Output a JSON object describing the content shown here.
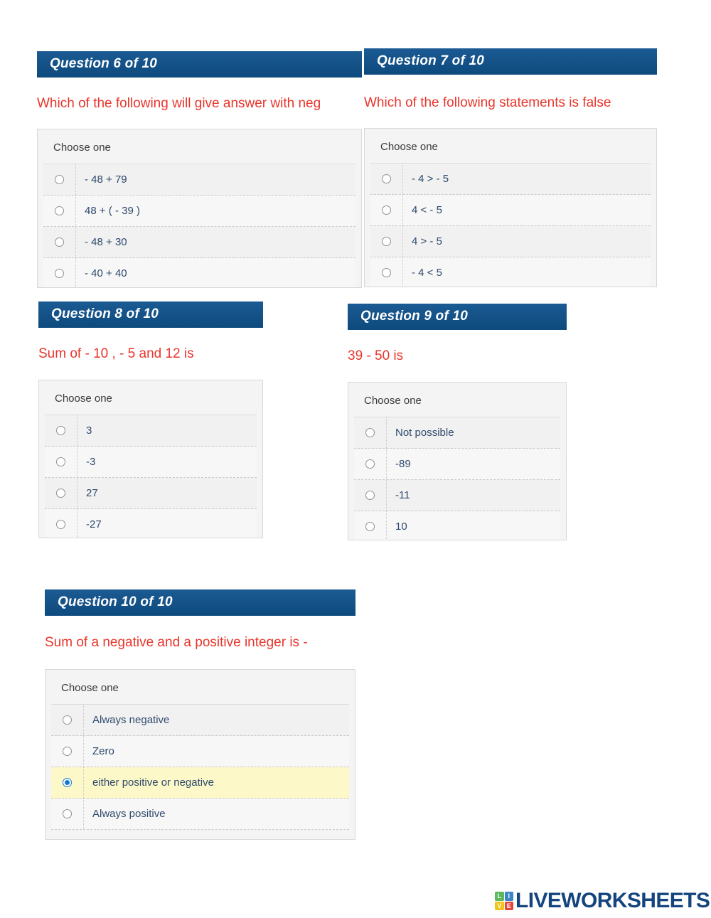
{
  "worksheet": {
    "choose_one_label": "Choose one",
    "questions": [
      {
        "id": "q6",
        "header": "Question 6 of 10",
        "prompt": "Which of the following will give answer with neg",
        "options": [
          {
            "label": "- 48 + 79",
            "selected": false
          },
          {
            "label": "48 + ( - 39 )",
            "selected": false
          },
          {
            "label": "- 48 + 30",
            "selected": false
          },
          {
            "label": "- 40 + 40",
            "selected": false
          }
        ]
      },
      {
        "id": "q7",
        "header": "Question 7 of 10",
        "prompt": "Which of the following statements is false",
        "options": [
          {
            "label": "- 4 > - 5",
            "selected": false
          },
          {
            "label": "4 < - 5",
            "selected": false
          },
          {
            "label": "4 > - 5",
            "selected": false
          },
          {
            "label": "- 4 < 5",
            "selected": false
          }
        ]
      },
      {
        "id": "q8",
        "header": "Question 8 of 10",
        "prompt": "Sum of - 10 , - 5 and 12 is",
        "options": [
          {
            "label": "3",
            "selected": false
          },
          {
            "label": "-3",
            "selected": false
          },
          {
            "label": "27",
            "selected": false
          },
          {
            "label": "-27",
            "selected": false
          }
        ]
      },
      {
        "id": "q9",
        "header": "Question 9 of 10",
        "prompt": "39 - 50 is",
        "options": [
          {
            "label": "Not possible",
            "selected": false
          },
          {
            "label": "-89",
            "selected": false
          },
          {
            "label": "-11",
            "selected": false
          },
          {
            "label": "10",
            "selected": false
          }
        ]
      },
      {
        "id": "q10",
        "header": "Question 10 of 10",
        "prompt": "Sum of a negative and a positive integer is -",
        "options": [
          {
            "label": "Always negative",
            "selected": false
          },
          {
            "label": "Zero",
            "selected": false
          },
          {
            "label": "either positive or negative",
            "selected": true
          },
          {
            "label": "Always positive",
            "selected": false
          }
        ]
      }
    ]
  },
  "footer": {
    "logo_tiles": [
      "L",
      "I",
      "V",
      "E"
    ],
    "logo_word": "LIVEWORKSHEETS"
  },
  "colors": {
    "header_blue": "#0f4c81",
    "question_red": "#e8352b",
    "option_text": "#2f4a6d",
    "selected_row": "#fcf8c8",
    "radio_on": "#1478d4",
    "logo_navy": "#15457e"
  }
}
